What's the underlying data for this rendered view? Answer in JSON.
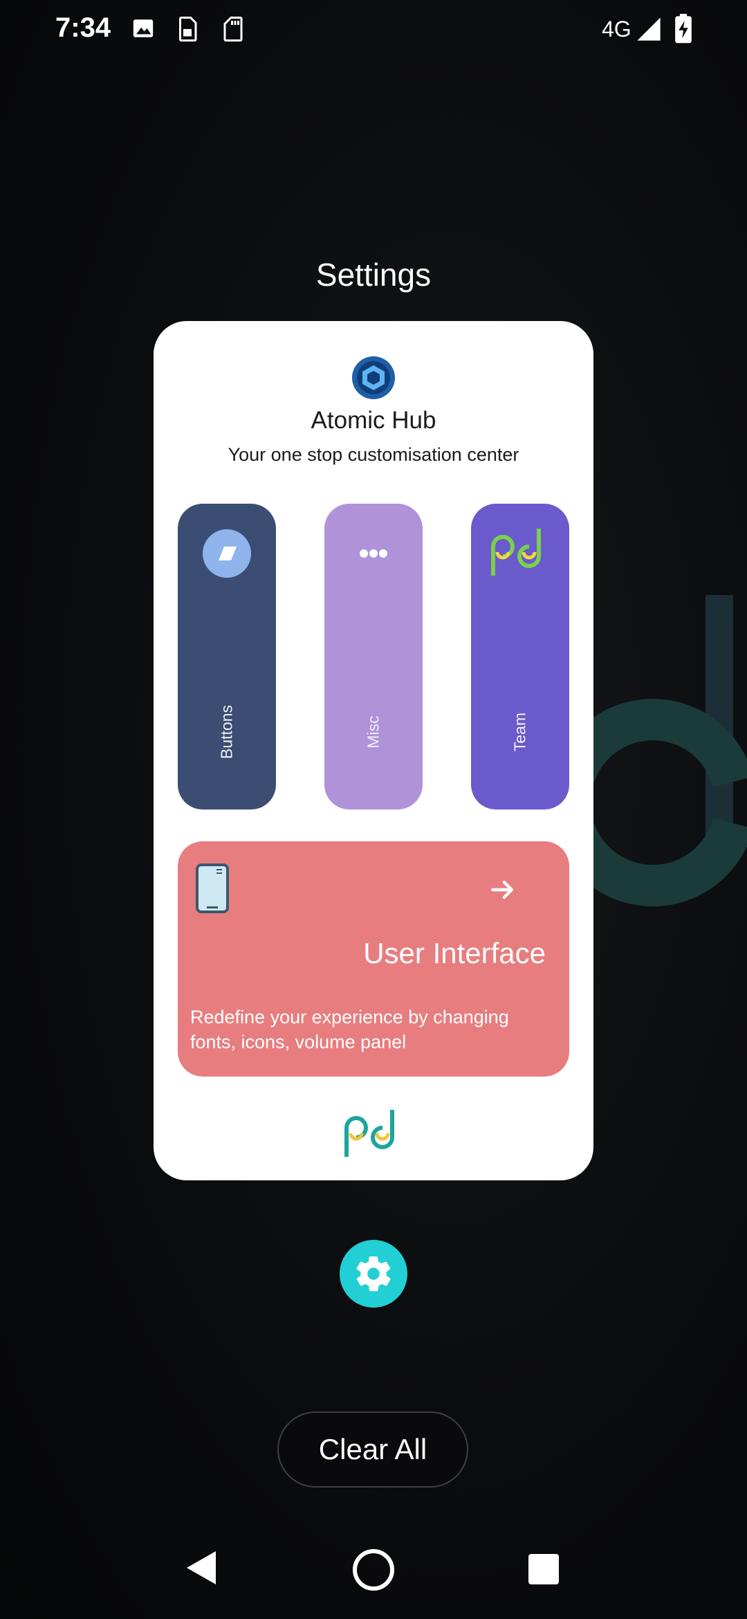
{
  "status_bar": {
    "time": "7:34",
    "network": "4G",
    "icons": [
      "image-icon",
      "sim-icon",
      "sd-card-icon",
      "signal-icon",
      "battery-charging-icon"
    ]
  },
  "recents": {
    "title": "Settings"
  },
  "app_card": {
    "app_name": "Atomic Hub",
    "tagline": "Your one stop customisation center",
    "tiles": [
      {
        "label": "Buttons",
        "icon": "eraser-icon",
        "color": "#3b4d72"
      },
      {
        "label": "Misc",
        "icon": "more-dots-icon",
        "color": "#b092d8"
      },
      {
        "label": "Team",
        "icon": "pd-logo-icon",
        "color": "#6b5acb"
      }
    ],
    "feature": {
      "title": "User Interface",
      "description": "Redefine your experience by changing fonts, icons, volume panel",
      "icon": "phone-icon",
      "action_icon": "arrow-right-icon",
      "color": "#e87d7f"
    }
  },
  "fab": {
    "icon": "gear-icon",
    "color": "#22cfd4"
  },
  "actions": {
    "clear_all": "Clear All"
  },
  "nav": {
    "icons": [
      "back-icon",
      "home-icon",
      "recents-icon"
    ]
  }
}
